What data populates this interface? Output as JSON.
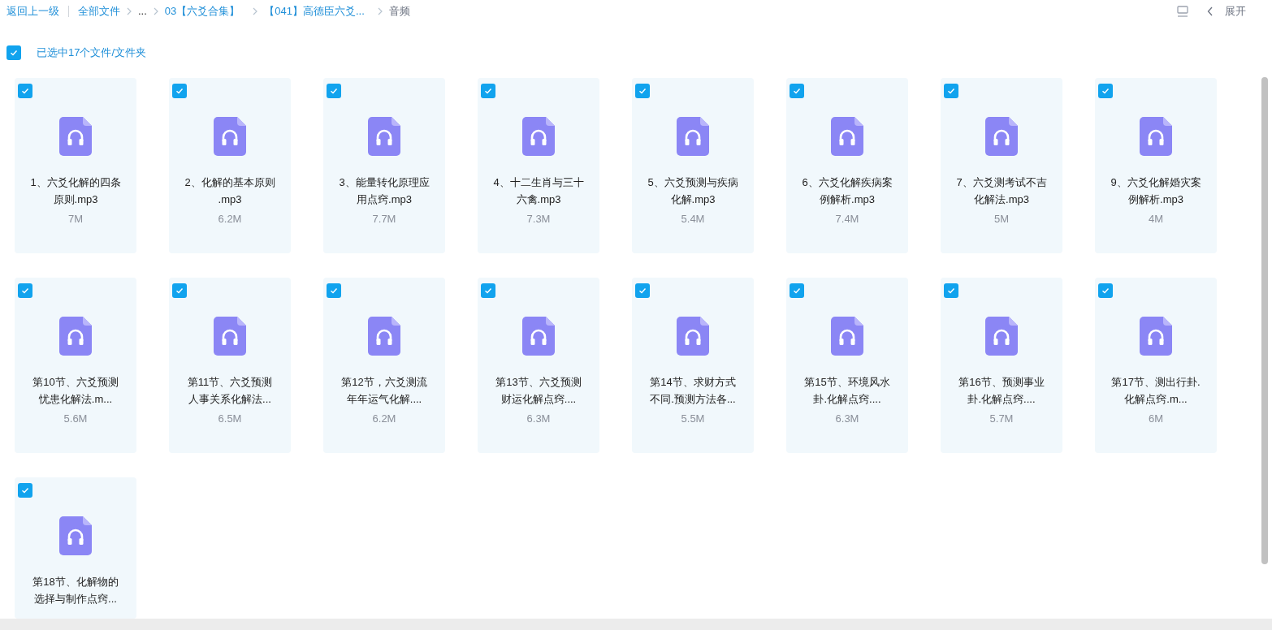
{
  "breadcrumb": {
    "back": "返回上一级",
    "items": [
      {
        "label": "全部文件",
        "current": false
      },
      {
        "label": "...",
        "current": false
      },
      {
        "label": "03【六爻合集】",
        "current": false
      },
      {
        "label": "【041】高德臣六爻...",
        "current": false
      },
      {
        "label": "音频",
        "current": true
      }
    ]
  },
  "toolbar": {
    "expand": "展开"
  },
  "selection": {
    "checked": true,
    "label": "已选中17个文件/文件夹"
  },
  "files": [
    {
      "checked": true,
      "name_lines": [
        "1、六爻化解的四条",
        "原则.mp3"
      ],
      "size": "7M"
    },
    {
      "checked": true,
      "name_lines": [
        "2、化解的基本原则",
        ".mp3"
      ],
      "size": "6.2M"
    },
    {
      "checked": true,
      "name_lines": [
        "3、能量转化原理应",
        "用点窍.mp3"
      ],
      "size": "7.7M"
    },
    {
      "checked": true,
      "name_lines": [
        "4、十二生肖与三十",
        "六禽.mp3"
      ],
      "size": "7.3M"
    },
    {
      "checked": true,
      "name_lines": [
        "5、六爻预测与疾病",
        "化解.mp3"
      ],
      "size": "5.4M"
    },
    {
      "checked": true,
      "name_lines": [
        "6、六爻化解疾病案",
        "例解析.mp3"
      ],
      "size": "7.4M"
    },
    {
      "checked": true,
      "name_lines": [
        "7、六爻测考试不吉",
        "化解法.mp3"
      ],
      "size": "5M"
    },
    {
      "checked": true,
      "name_lines": [
        "9、六爻化解婚灾案",
        "例解析.mp3"
      ],
      "size": "4M"
    },
    {
      "checked": true,
      "name_lines": [
        "第10节、六爻预测",
        "忧患化解法.m..."
      ],
      "size": "5.6M"
    },
    {
      "checked": true,
      "name_lines": [
        "第11节、六爻预测",
        "人事关系化解法..."
      ],
      "size": "6.5M"
    },
    {
      "checked": true,
      "name_lines": [
        "第12节，六爻测流",
        "年年运气化解...."
      ],
      "size": "6.2M"
    },
    {
      "checked": true,
      "name_lines": [
        "第13节、六爻预测",
        "财运化解点窍...."
      ],
      "size": "6.3M"
    },
    {
      "checked": true,
      "name_lines": [
        "第14节、求财方式",
        "不同.预测方法各..."
      ],
      "size": "5.5M"
    },
    {
      "checked": true,
      "name_lines": [
        "第15节、环境风水",
        "卦.化解点窍...."
      ],
      "size": "6.3M"
    },
    {
      "checked": true,
      "name_lines": [
        "第16节、预测事业",
        "卦.化解点窍...."
      ],
      "size": "5.7M"
    },
    {
      "checked": true,
      "name_lines": [
        "第17节、测出行卦.",
        "化解点窍.m..."
      ],
      "size": "6M"
    },
    {
      "checked": true,
      "name_lines": [
        "第18节、化解物的",
        "选择与制作点窍..."
      ]
    }
  ]
}
